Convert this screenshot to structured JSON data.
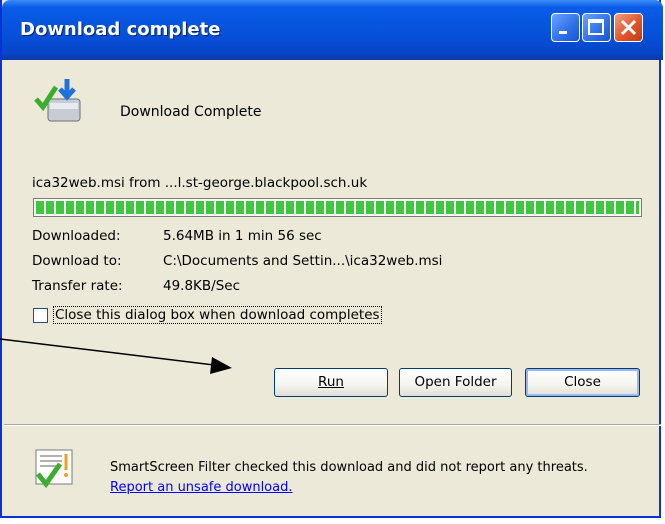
{
  "window": {
    "title": "Download complete"
  },
  "header": {
    "text": "Download Complete",
    "icon": "download-complete-icon"
  },
  "file": {
    "line": "ica32web.msi from ...l.st-george.blackpool.sch.uk"
  },
  "progress": {
    "percent": 100,
    "color": "#3fc83f"
  },
  "info": [
    {
      "label": "Downloaded:",
      "value": "5.64MB in 1 min 56 sec"
    },
    {
      "label": "Download to:",
      "value": "C:\\Documents and Settin...\\ica32web.msi"
    },
    {
      "label": "Transfer rate:",
      "value": "49.8KB/Sec"
    }
  ],
  "checkbox": {
    "label": "Close this dialog box when download completes",
    "checked": false
  },
  "buttons": {
    "run": "Run",
    "open_folder": "Open Folder",
    "close": "Close"
  },
  "smartscreen": {
    "text": "SmartScreen Filter checked this download and did not report any threats.",
    "link": "Report an unsafe download."
  },
  "colors": {
    "titlebar": "#0550d8",
    "dialog_bg": "#ece9d8",
    "link": "#0000ff"
  }
}
